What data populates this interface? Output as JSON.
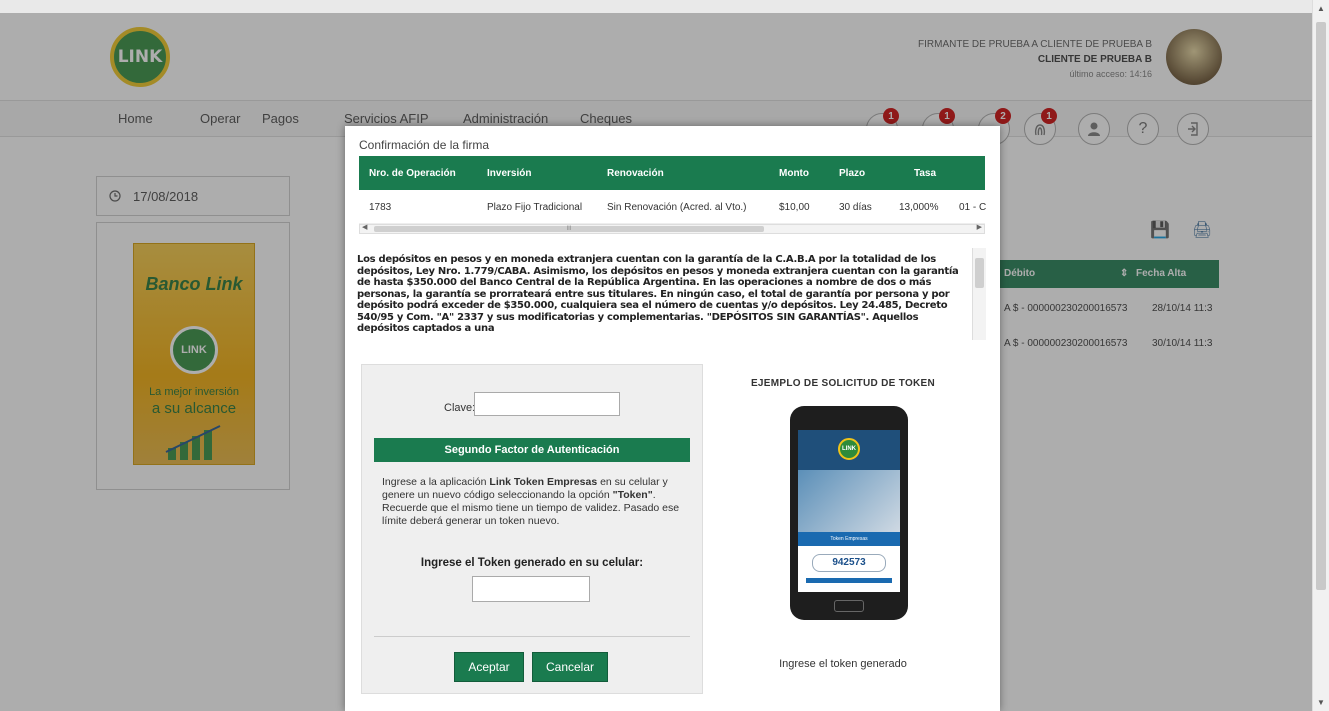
{
  "header": {
    "logo_text": "LINK",
    "user_line1": "FIRMANTE DE PRUEBA A CLIENTE DE PRUEBA B",
    "user_line2": "CLIENTE DE PRUEBA B",
    "user_line3": "último acceso: 14:16"
  },
  "nav": {
    "items": [
      "Home",
      "Operar",
      "Pagos",
      "Servicios AFIP",
      "Administración",
      "Cheques"
    ],
    "badges": [
      "1",
      "1",
      "2",
      "1"
    ],
    "help_icon": "?",
    "icons": [
      "bell-icon",
      "bell-icon",
      "bell-icon",
      "fingerprint-icon",
      "user-icon",
      "help-icon",
      "logout-icon"
    ]
  },
  "sidebar": {
    "date": "17/08/2018",
    "banner_title": "Banco Link",
    "banner_logo": "LINK",
    "banner_line1": "La mejor inversión",
    "banner_line2": "a su alcance"
  },
  "background_table": {
    "col_debito": "Débito",
    "col_fecha": "Fecha Alta",
    "rows": [
      {
        "debito": "A $ - 000000230200016573",
        "fecha": "28/10/14 11:3"
      },
      {
        "debito": "A $ - 000000230200016573",
        "fecha": "30/10/14 11:3"
      }
    ]
  },
  "modal": {
    "title": "Confirmación de la firma",
    "columns": [
      "Nro. de Operación",
      "Inversión",
      "Renovación",
      "Monto",
      "Plazo",
      "Tasa"
    ],
    "row": {
      "operacion": "1783",
      "inversion": "Plazo Fijo Tradicional",
      "renovacion": "Sin Renovación (Acred. al Vto.)",
      "monto": "$10,00",
      "plazo": "30 días",
      "tasa": "13,000%",
      "extra": "01 - C"
    },
    "legal_text": "Los depósitos en pesos y en moneda extranjera cuentan con la garantía de la C.A.B.A por la totalidad de los depósitos, Ley Nro. 1.779/CABA. Asimismo, los depósitos en pesos y moneda extranjera cuentan con la garantía de hasta $350.000 del Banco Central de la República Argentina. En las operaciones a nombre de dos o más personas, la garantía se prorrateará entre sus titulares. En ningún caso, el total de garantía por persona y por depósito podrá exceder de $350.000, cualquiera sea el número de cuentas y/o depósitos. Ley 24.485, Decreto 540/95 y Com. \"A\" 2337 y sus modificatorias y complementarias. \"DEPÓSITOS SIN GARANTÍAS\". Aquellos depósitos captados a una",
    "clave_label": "Clave:",
    "auth_header": "Segundo Factor de Autenticación",
    "auth_desc_pre": "Ingrese a la aplicación ",
    "auth_desc_app": "Link Token Empresas",
    "auth_desc_mid": " en su celular y genere un nuevo código seleccionando la opción ",
    "auth_desc_opt": "\"Token\"",
    "auth_desc_post": ". Recuerde que el mismo tiene un tiempo de validez. Pasado ese límite deberá generar un token nuevo.",
    "token_label": "Ingrese el Token generado en su celular:",
    "accept_label": "Aceptar",
    "cancel_label": "Cancelar",
    "example_title": "EJEMPLO DE SOLICITUD DE TOKEN",
    "example_code": "942573",
    "example_bar": "Token Empresas",
    "example_caption": "Ingrese el token generado"
  },
  "colors": {
    "primary_green": "#1a7b4f",
    "badge_red": "#cc0000",
    "banner_yellow": "#f2a900"
  }
}
